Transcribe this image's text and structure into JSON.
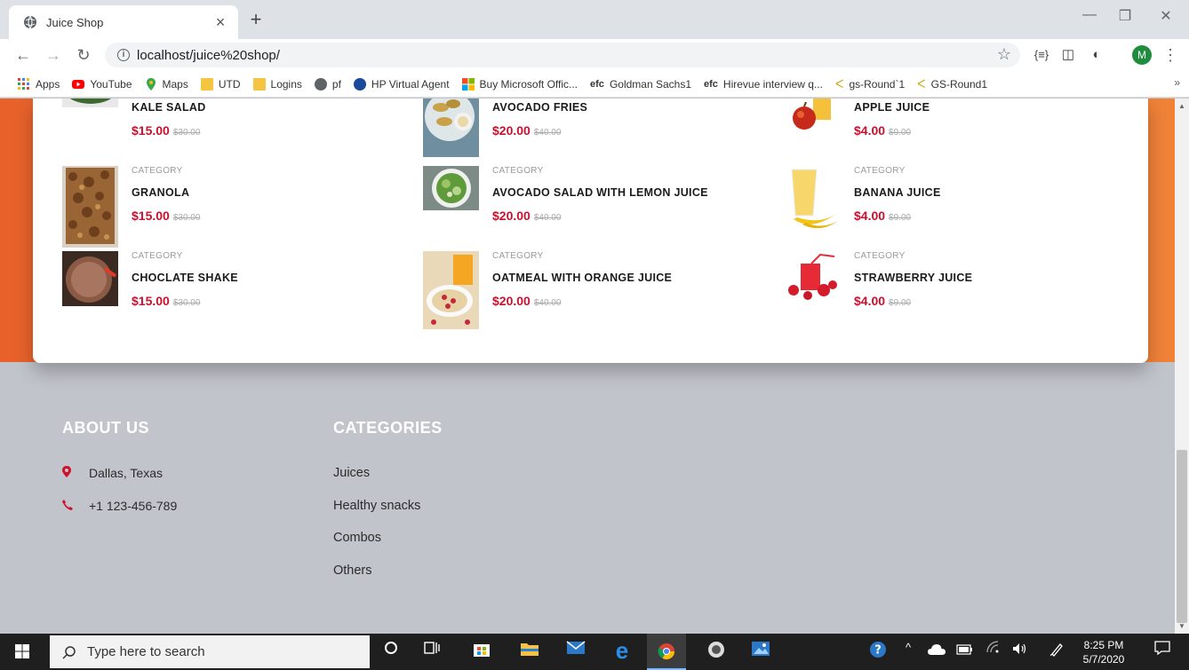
{
  "browser": {
    "tab_title": "Juice Shop",
    "tab_close": "×",
    "new_tab": "+",
    "url": "localhost/juice%20shop/",
    "avatar_initial": "M",
    "bookmarks": [
      {
        "label": "Apps",
        "icon": "apps-icon"
      },
      {
        "label": "YouTube",
        "icon": "youtube-icon"
      },
      {
        "label": "Maps",
        "icon": "maps-icon"
      },
      {
        "label": "UTD",
        "icon": "folder-icon"
      },
      {
        "label": "Logins",
        "icon": "folder-icon"
      },
      {
        "label": "pf",
        "icon": "globe-icon"
      },
      {
        "label": "HP Virtual Agent",
        "icon": "hp-icon"
      },
      {
        "label": "Buy Microsoft Offic...",
        "icon": "microsoft-icon"
      },
      {
        "label": "Goldman Sachs1",
        "icon": "efc-icon"
      },
      {
        "label": "Hirevue interview q...",
        "icon": "efc-icon"
      },
      {
        "label": "gs-Round`1",
        "icon": "gs-icon"
      },
      {
        "label": "GS-Round1",
        "icon": "gs-icon"
      }
    ],
    "bookmarks_more": "»"
  },
  "products": [
    {
      "category": "",
      "name": "KALE SALAD",
      "price": "$15.00",
      "old_price": "$30.00"
    },
    {
      "category": "",
      "name": "AVOCADO FRIES",
      "price": "$20.00",
      "old_price": "$40.00"
    },
    {
      "category": "",
      "name": "APPLE JUICE",
      "price": "$4.00",
      "old_price": "$9.00"
    },
    {
      "category": "CATEGORY",
      "name": "GRANOLA",
      "price": "$15.00",
      "old_price": "$30.00"
    },
    {
      "category": "CATEGORY",
      "name": "AVOCADO SALAD WITH LEMON JUICE",
      "price": "$20.00",
      "old_price": "$40.00"
    },
    {
      "category": "CATEGORY",
      "name": "BANANA JUICE",
      "price": "$4.00",
      "old_price": "$9.00"
    },
    {
      "category": "CATEGORY",
      "name": "CHOCLATE SHAKE",
      "price": "$15.00",
      "old_price": "$30.00"
    },
    {
      "category": "CATEGORY",
      "name": "OATMEAL WITH ORANGE JUICE",
      "price": "$20.00",
      "old_price": "$40.00"
    },
    {
      "category": "CATEGORY",
      "name": "STRAWBERRY JUICE",
      "price": "$4.00",
      "old_price": "$9.00"
    }
  ],
  "footer": {
    "about_title": "ABOUT US",
    "address": "Dallas, Texas",
    "phone": "+1 123-456-789",
    "categories_title": "CATEGORIES",
    "categories": [
      "Juices",
      "Healthy snacks",
      "Combos",
      "Others"
    ]
  },
  "taskbar": {
    "search_placeholder": "Type here to search",
    "time": "8:25 PM",
    "date": "5/7/2020"
  },
  "colors": {
    "accent": "#c8102e",
    "band_left": "#e8612b",
    "band_right": "#f08238",
    "footer_bg": "#c2c4cc"
  }
}
